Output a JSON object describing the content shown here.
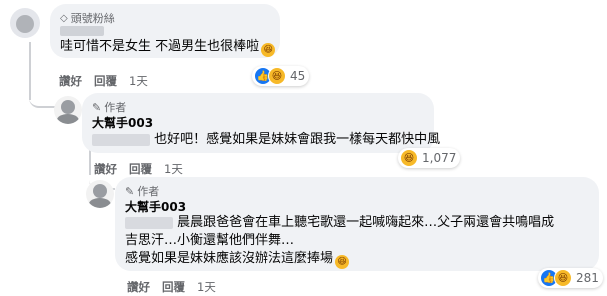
{
  "comments": [
    {
      "badge_label": "頭號粉絲",
      "badge_icon": "diamond-icon",
      "text": "哇可惜不是女生 不過男生也很棒啦",
      "actions": [
        "讚好",
        "回覆",
        "1天"
      ],
      "reaction_count": "45",
      "reactions": [
        "like-icon",
        "haha-icon"
      ]
    },
    {
      "badge_label": "作者",
      "badge_icon": "pencil-icon",
      "author": "大幫手003",
      "text": "也好吧！感覺如果是妹妹會跟我一樣每天都快中風",
      "actions": [
        "讚好",
        "回覆",
        "1天"
      ],
      "reaction_count": "1,077",
      "reactions": [
        "haha-icon"
      ]
    },
    {
      "badge_label": "作者",
      "badge_icon": "pencil-icon",
      "author": "大幫手003",
      "text_lines": [
        "晨晨跟爸爸會在車上聽宅歌還一起喊嗨起來…父子兩還會共鳴唱成",
        "吉思汗…小衡還幫他們伴舞…",
        "感覺如果是妹妹應該沒辦法這麼捧場"
      ],
      "actions": [
        "讚好",
        "回覆",
        "1天"
      ],
      "reaction_count": "281",
      "reactions": [
        "like-icon",
        "haha-icon"
      ]
    }
  ],
  "colors": {
    "bubble": "#f0f2f5",
    "text": "#050505",
    "meta": "#65676b",
    "like": "#1877f2",
    "haha": "#f7b928",
    "thread_line": "#ced0d4"
  }
}
